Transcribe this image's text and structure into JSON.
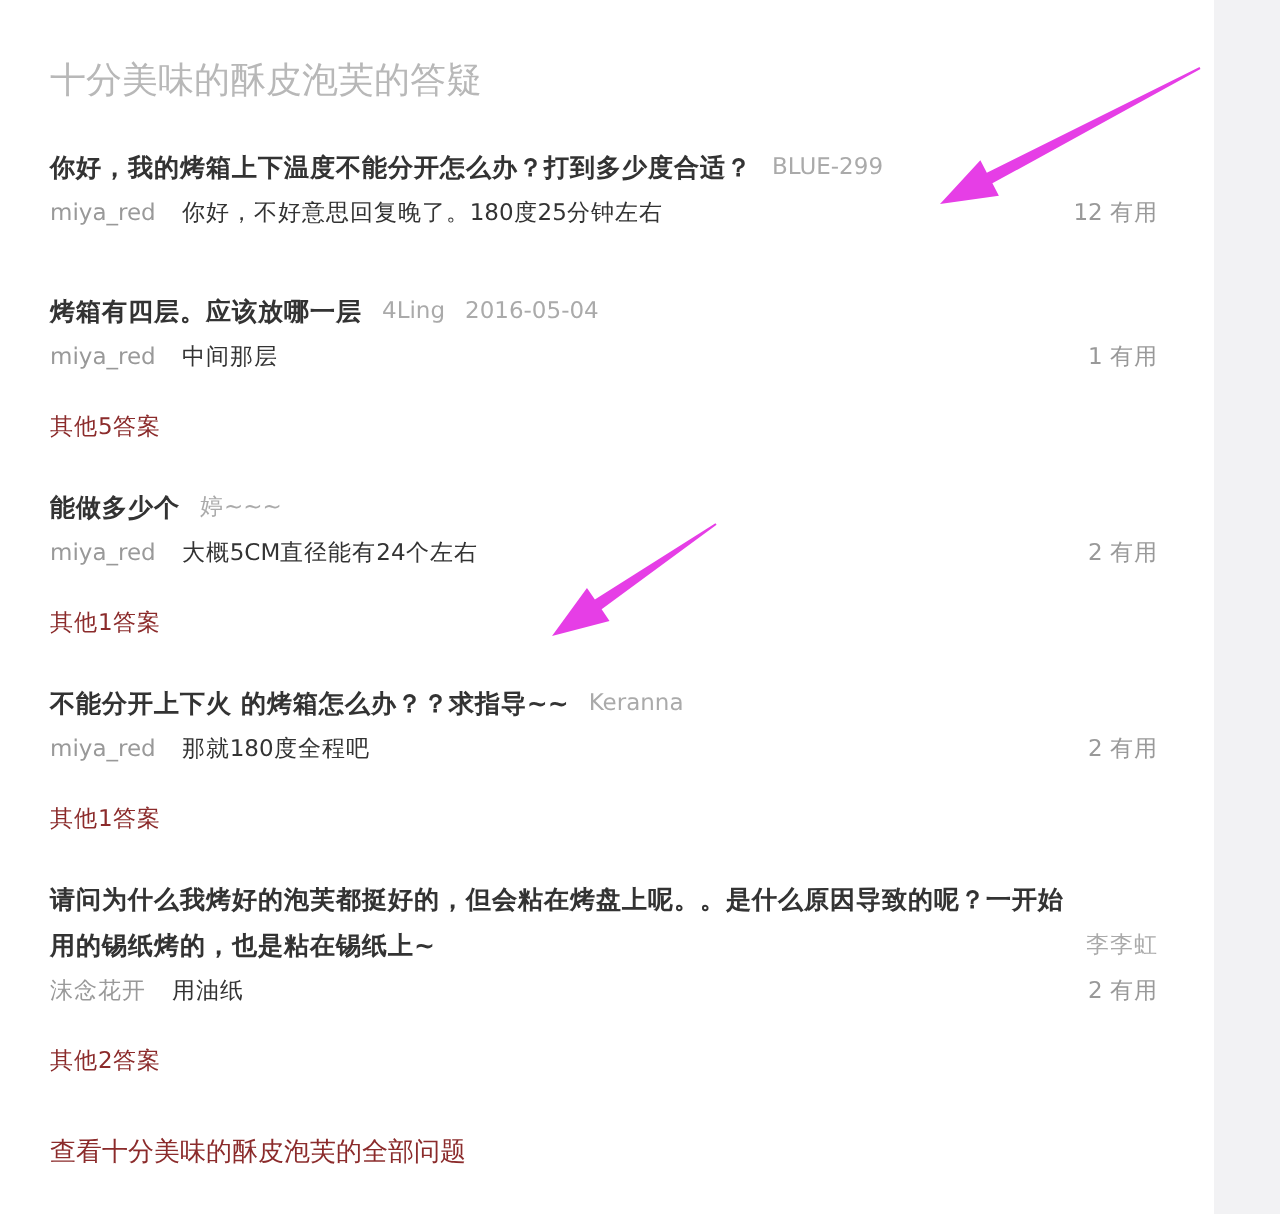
{
  "title": "十分美味的酥皮泡芙的答疑",
  "questions": [
    {
      "text": "你好，我的烤箱上下温度不能分开怎么办？打到多少度合适？",
      "asker": "BLUE-299",
      "answerer": "miya_red",
      "answer": "你好，不好意思回复晚了。180度25分钟左右",
      "useful": "12 有用"
    },
    {
      "text": "烤箱有四层。应该放哪一层",
      "asker": "4Ling",
      "date": "2016-05-04",
      "answerer": "miya_red",
      "answer": "中间那层",
      "useful": "1 有用",
      "more": "其他5答案"
    },
    {
      "text": "能做多少个",
      "asker": "婷~~~",
      "answerer": "miya_red",
      "answer": "大概5CM直径能有24个左右",
      "useful": "2 有用",
      "more": "其他1答案"
    },
    {
      "text": "不能分开上下火 的烤箱怎么办？？求指导~~",
      "asker": "Keranna",
      "answerer": "miya_red",
      "answer": "那就180度全程吧",
      "useful": "2 有用",
      "more": "其他1答案"
    },
    {
      "text": "请问为什么我烤好的泡芙都挺好的，但会粘在烤盘上呢。。是什么原因导致的呢？一开始用的锡纸烤的，也是粘在锡纸上~",
      "asker": "李李虹",
      "answerer": "沫念花开",
      "answer": "用油纸",
      "useful": "2 有用",
      "more": "其他2答案"
    }
  ],
  "all_link": "查看十分美味的酥皮泡芙的全部问题"
}
